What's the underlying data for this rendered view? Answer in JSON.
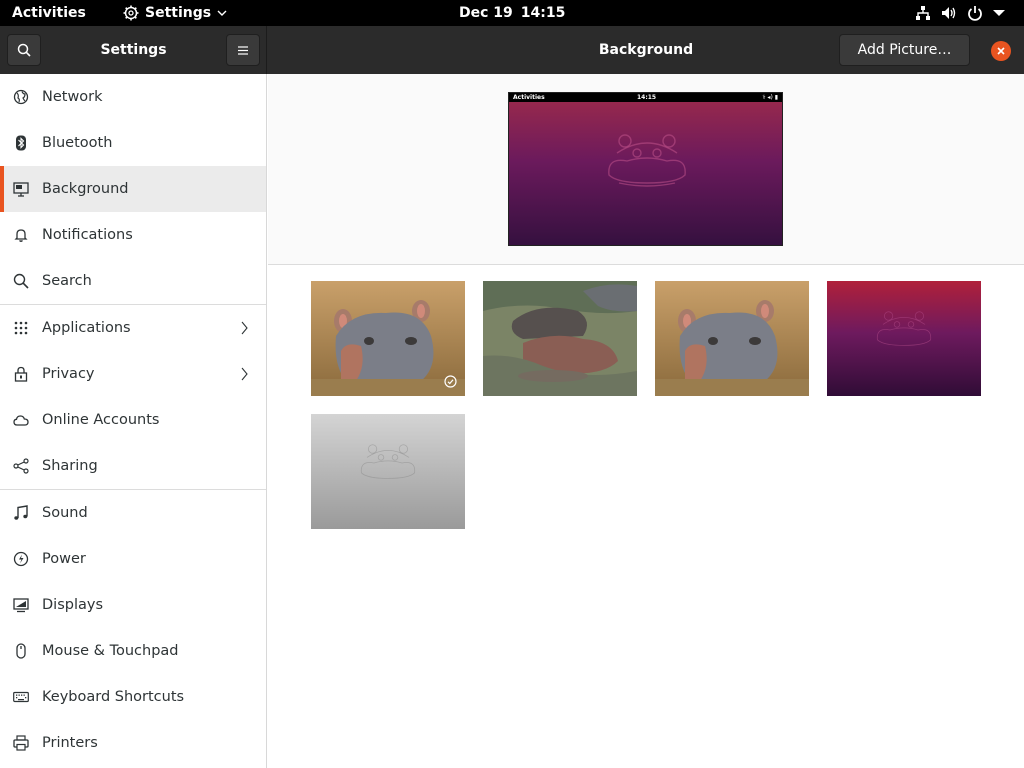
{
  "topbar": {
    "activities": "Activities",
    "app_name": "Settings",
    "date": "Dec 19",
    "time": "14:15"
  },
  "header": {
    "sidebar_title": "Settings",
    "title": "Background",
    "add_picture": "Add Picture…"
  },
  "sidebar": {
    "items": [
      {
        "label": "Network",
        "icon": "globe-icon"
      },
      {
        "label": "Bluetooth",
        "icon": "bluetooth-icon"
      },
      {
        "label": "Background",
        "icon": "monitor-icon",
        "selected": true
      },
      {
        "label": "Notifications",
        "icon": "bell-icon"
      },
      {
        "label": "Search",
        "icon": "search-icon"
      },
      {
        "label": "Applications",
        "icon": "grid-icon",
        "has_arrow": true
      },
      {
        "label": "Privacy",
        "icon": "lock-icon",
        "has_arrow": true
      },
      {
        "label": "Online Accounts",
        "icon": "cloud-icon"
      },
      {
        "label": "Sharing",
        "icon": "share-icon"
      },
      {
        "label": "Sound",
        "icon": "music-note-icon"
      },
      {
        "label": "Power",
        "icon": "power-icon"
      },
      {
        "label": "Displays",
        "icon": "display-icon"
      },
      {
        "label": "Mouse & Touchpad",
        "icon": "mouse-icon"
      },
      {
        "label": "Keyboard Shortcuts",
        "icon": "keyboard-icon"
      },
      {
        "label": "Printers",
        "icon": "printer-icon"
      }
    ]
  },
  "preview": {
    "activities": "Activities",
    "time": "14:15"
  },
  "wallpapers": [
    {
      "name": "hippo-closeup",
      "selected": true
    },
    {
      "name": "hippos-in-water",
      "selected": false
    },
    {
      "name": "hippo-closeup-alt",
      "selected": false
    },
    {
      "name": "purple-gradient-hippo",
      "selected": false
    },
    {
      "name": "gray-gradient-hippo",
      "selected": false
    }
  ],
  "colors": {
    "accent": "#e95420",
    "header_bg": "#2b2b2b",
    "topbar_bg": "#000000"
  }
}
